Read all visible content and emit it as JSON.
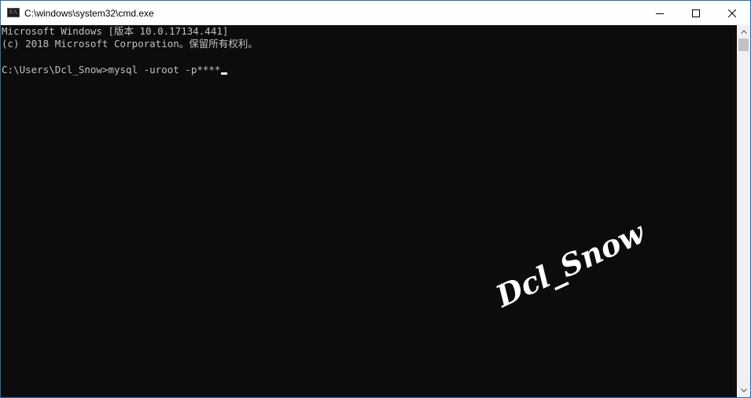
{
  "window": {
    "title": "C:\\windows\\system32\\cmd.exe",
    "icon": "cmd-icon",
    "icon_text": "C:\\",
    "controls": {
      "minimize": "minimize-icon",
      "maximize": "maximize-icon",
      "close": "close-icon"
    }
  },
  "console": {
    "lines": [
      "Microsoft Windows [版本 10.0.17134.441]",
      "(c) 2018 Microsoft Corporation。保留所有权利。",
      "",
      "C:\\Users\\Dcl_Snow>mysql -uroot -p****"
    ],
    "background": "#0c0c0c",
    "foreground": "#c0c0c0"
  },
  "watermark": {
    "text": "Dcl_Snow"
  },
  "scrollbar": {
    "up_icon": "scroll-up-arrow-icon",
    "down_icon": "scroll-down-arrow-icon"
  }
}
